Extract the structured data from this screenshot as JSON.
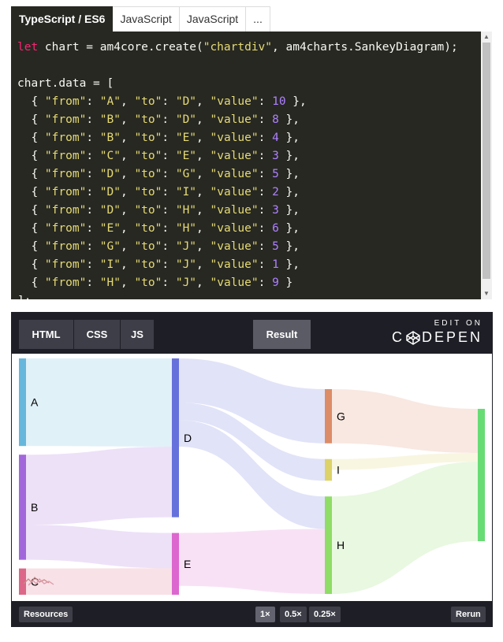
{
  "tabs": [
    "TypeScript / ES6",
    "JavaScript",
    "JavaScript",
    "..."
  ],
  "code": {
    "line1": {
      "keyword": "let",
      "text": " chart = am4core.create(",
      "str1": "\"chartdiv\"",
      "text2": ", am4charts.SankeyDiagram);"
    },
    "line3": "chart.data = [",
    "rows": [
      {
        "from": "A",
        "to": "D",
        "value": "10"
      },
      {
        "from": "B",
        "to": "D",
        "value": "8"
      },
      {
        "from": "B",
        "to": "E",
        "value": "4"
      },
      {
        "from": "C",
        "to": "E",
        "value": "3"
      },
      {
        "from": "D",
        "to": "G",
        "value": "5"
      },
      {
        "from": "D",
        "to": "I",
        "value": "2"
      },
      {
        "from": "D",
        "to": "H",
        "value": "3"
      },
      {
        "from": "E",
        "to": "H",
        "value": "6"
      },
      {
        "from": "G",
        "to": "J",
        "value": "5"
      },
      {
        "from": "I",
        "to": "J",
        "value": "1"
      },
      {
        "from": "H",
        "to": "J",
        "value": "9"
      }
    ],
    "tokens": {
      "open": "  { ",
      "from_key": "\"from\"",
      "to_key": "\"to\"",
      "value_key": "\"value\"",
      "colon": ": ",
      "comma": ", ",
      "close_comma": " },",
      "close_last": " }"
    },
    "last_line": "];"
  },
  "pen": {
    "tabs": [
      "HTML",
      "CSS",
      "JS"
    ],
    "result_label": "Result",
    "edit_on": "EDIT ON",
    "brand_left": "C",
    "brand_right": "DEPEN",
    "footer": {
      "resources": "Resources",
      "zoom": [
        "1×",
        "0.5×",
        "0.25×"
      ],
      "rerun": "Rerun"
    }
  },
  "chart_data": {
    "type": "sankey",
    "nodes": [
      {
        "id": "A",
        "label": "A",
        "color": "#67b7dc"
      },
      {
        "id": "B",
        "label": "B",
        "color": "#a367dc"
      },
      {
        "id": "C",
        "label": "C",
        "color": "#dc6788"
      },
      {
        "id": "D",
        "label": "D",
        "color": "#6771dc"
      },
      {
        "id": "E",
        "label": "E",
        "color": "#dc67ce"
      },
      {
        "id": "G",
        "label": "G",
        "color": "#dc8c67"
      },
      {
        "id": "I",
        "label": "I",
        "color": "#dcd267"
      },
      {
        "id": "H",
        "label": "H",
        "color": "#8fdc67"
      },
      {
        "id": "J",
        "label": "",
        "color": "#67dc75"
      }
    ],
    "links": [
      {
        "from": "A",
        "to": "D",
        "value": 10
      },
      {
        "from": "B",
        "to": "D",
        "value": 8
      },
      {
        "from": "B",
        "to": "E",
        "value": 4
      },
      {
        "from": "C",
        "to": "E",
        "value": 3
      },
      {
        "from": "D",
        "to": "G",
        "value": 5
      },
      {
        "from": "D",
        "to": "I",
        "value": 2
      },
      {
        "from": "D",
        "to": "H",
        "value": 3
      },
      {
        "from": "E",
        "to": "H",
        "value": 6
      },
      {
        "from": "G",
        "to": "J",
        "value": 5
      },
      {
        "from": "I",
        "to": "J",
        "value": 1
      },
      {
        "from": "H",
        "to": "J",
        "value": 9
      }
    ]
  }
}
